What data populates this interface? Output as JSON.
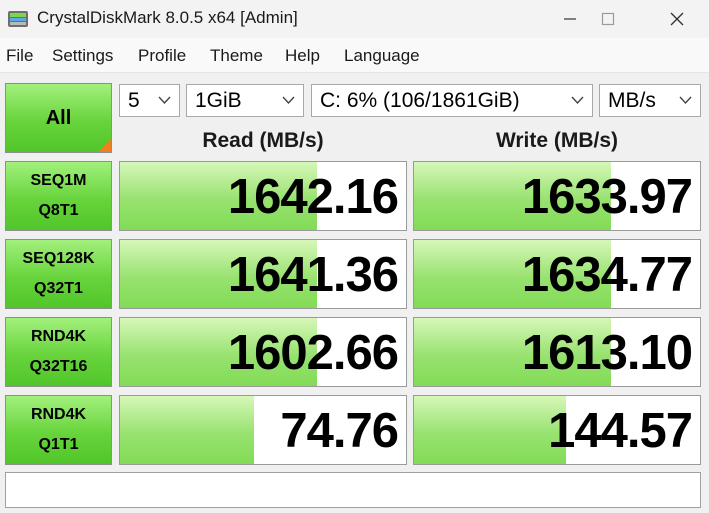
{
  "window": {
    "title": "CrystalDiskMark 8.0.5 x64 [Admin]",
    "controls": [
      "minimize-icon",
      "maximize-icon",
      "close-icon"
    ]
  },
  "menu": [
    "File",
    "Settings",
    "Profile",
    "Theme",
    "Help",
    "Language"
  ],
  "toolbar": {
    "all_label": "All",
    "count": "5",
    "size": "1GiB",
    "drive": "C: 6% (106/1861GiB)",
    "unit": "MB/s"
  },
  "columns": {
    "read": "Read (MB/s)",
    "write": "Write (MB/s)"
  },
  "tests": [
    {
      "line1": "SEQ1M",
      "line2": "Q8T1",
      "read": "1642.16",
      "write": "1633.97",
      "read_fill": 0.69,
      "write_fill": 0.69
    },
    {
      "line1": "SEQ128K",
      "line2": "Q32T1",
      "read": "1641.36",
      "write": "1634.77",
      "read_fill": 0.69,
      "write_fill": 0.69
    },
    {
      "line1": "RND4K",
      "line2": "Q32T16",
      "read": "1602.66",
      "write": "1613.10",
      "read_fill": 0.69,
      "write_fill": 0.69
    },
    {
      "line1": "RND4K",
      "line2": "Q1T1",
      "read": "74.76",
      "write": "144.57",
      "read_fill": 0.47,
      "write_fill": 0.53
    }
  ],
  "comment": "",
  "colors": {
    "button_green": "#68d43c",
    "bar_green": "#98e270",
    "corner_orange": "#f0801e"
  }
}
